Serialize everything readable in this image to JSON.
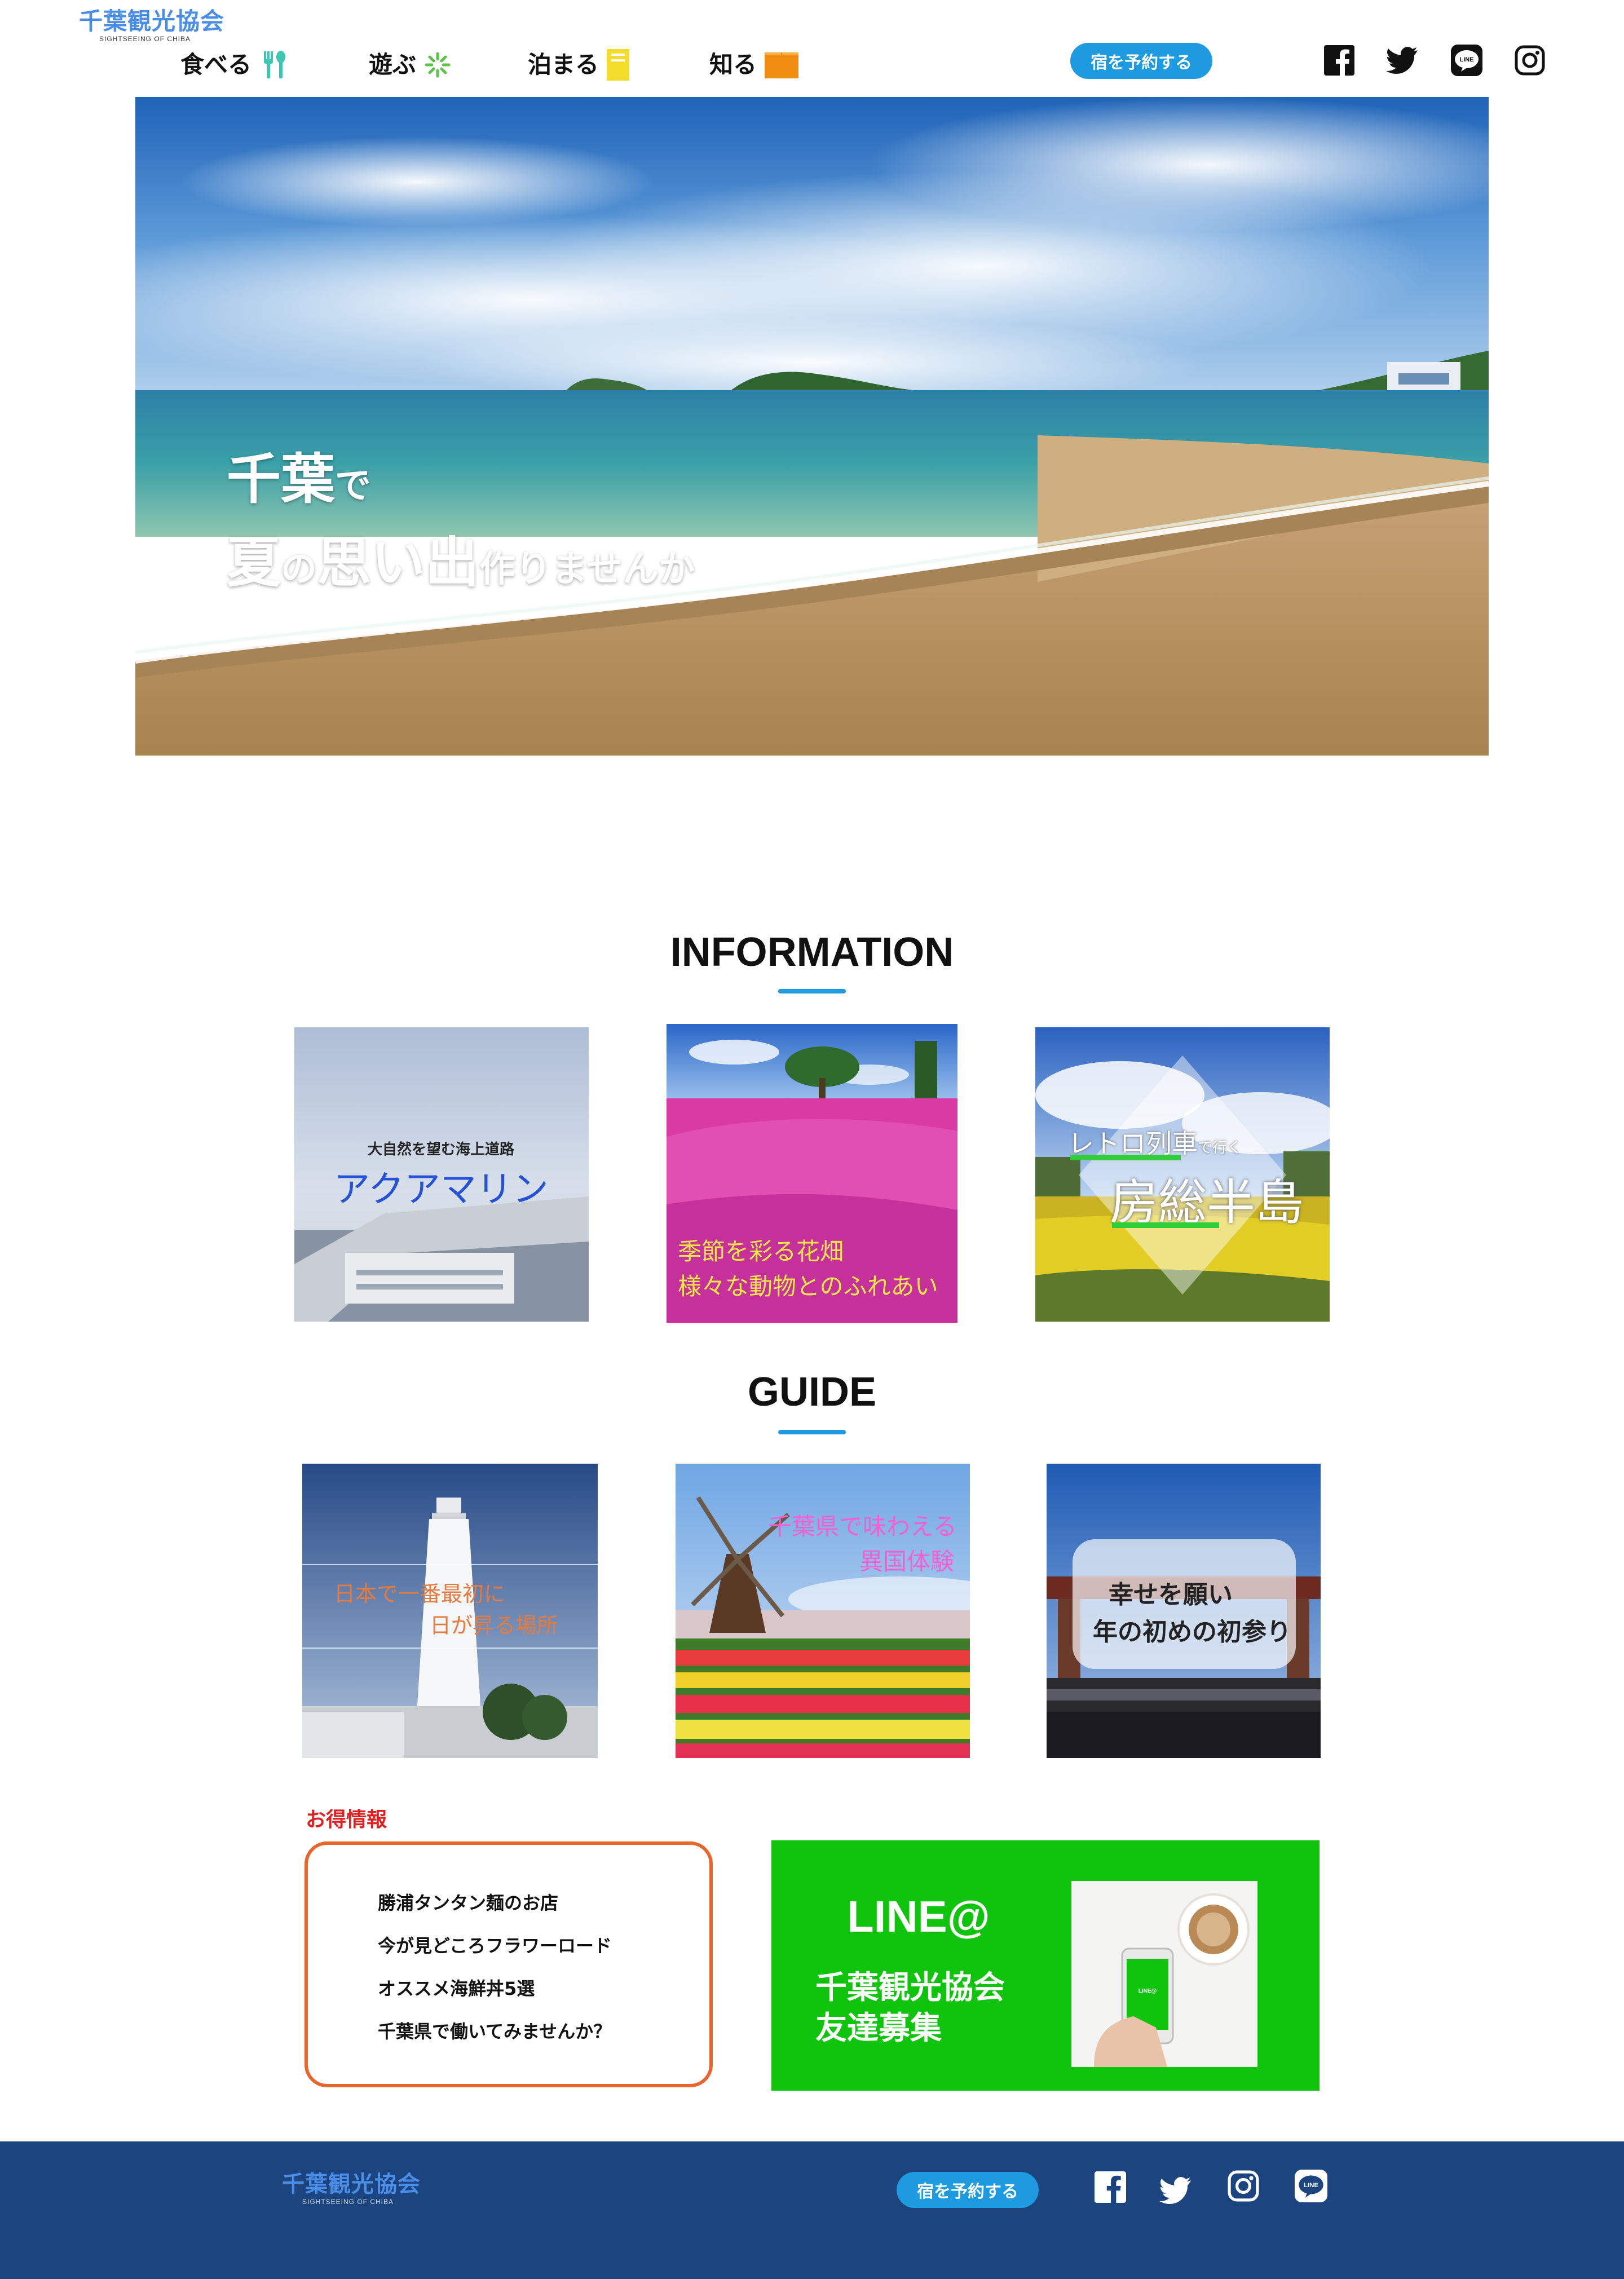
{
  "header": {
    "logo_text": "千葉観光協会",
    "logo_sub": "SIGHTSEEING OF CHIBA",
    "nav": [
      {
        "label": "食べる",
        "icon": "fork-spoon-icon",
        "color": "#3cc7b5"
      },
      {
        "label": "遊ぶ",
        "icon": "sparkle-icon",
        "color": "#5cc24a"
      },
      {
        "label": "泊まる",
        "icon": "building-icon",
        "color": "#f4dc2a"
      },
      {
        "label": "知る",
        "icon": "book-icon",
        "color": "#f08c12"
      }
    ],
    "reserve_label": "宿を予約する",
    "social": [
      "facebook-icon",
      "twitter-icon",
      "line-icon",
      "instagram-icon"
    ]
  },
  "hero": {
    "line1_big": "千葉",
    "line1_small": "で",
    "line2_parts": [
      {
        "text": "夏",
        "size": "big"
      },
      {
        "text": "の",
        "size": "small"
      },
      {
        "text": "思い出",
        "size": "big"
      },
      {
        "text": "作りませんか",
        "size": "small"
      }
    ]
  },
  "information": {
    "title": "INFORMATION",
    "cards": [
      {
        "kicker": "大自然を望む海上道路",
        "headline": "アクアマリン"
      },
      {
        "line1": "季節を彩る花畑",
        "line2": "様々な動物とのふれあい"
      },
      {
        "kicker_a": "レトロ列車",
        "kicker_b": "で行く",
        "headline": "房総半島"
      }
    ]
  },
  "guide": {
    "title": "GUIDE",
    "cards": [
      {
        "line1": "日本で一番最初に",
        "line2": "日が昇る場所"
      },
      {
        "line1": "千葉県で味わえる",
        "line2": "異国体験"
      },
      {
        "line1": "幸せを願い",
        "line2": "年の初めの初参り"
      }
    ]
  },
  "deals": {
    "title": "お得情報",
    "items": [
      "勝浦タンタン麺のお店",
      "今が見どころフラワーロード",
      "オススメ海鮮丼5選",
      "千葉県で働いてみませんか？"
    ]
  },
  "line_banner": {
    "title": "LINE@",
    "sub1": "千葉観光協会",
    "sub2": "友達募集",
    "phone_label": "LINE@"
  },
  "footer": {
    "logo_text": "千葉観光協会",
    "logo_sub": "SIGHTSEEING OF CHIBA",
    "reserve_label": "宿を予約する",
    "social": [
      "facebook-icon",
      "twitter-icon",
      "instagram-icon",
      "line-icon"
    ]
  },
  "colors": {
    "accent": "#1e9be0",
    "footer": "#1c4580",
    "deals_border": "#e8642a",
    "deals_title": "#e02020",
    "line_green": "#10c40e"
  }
}
